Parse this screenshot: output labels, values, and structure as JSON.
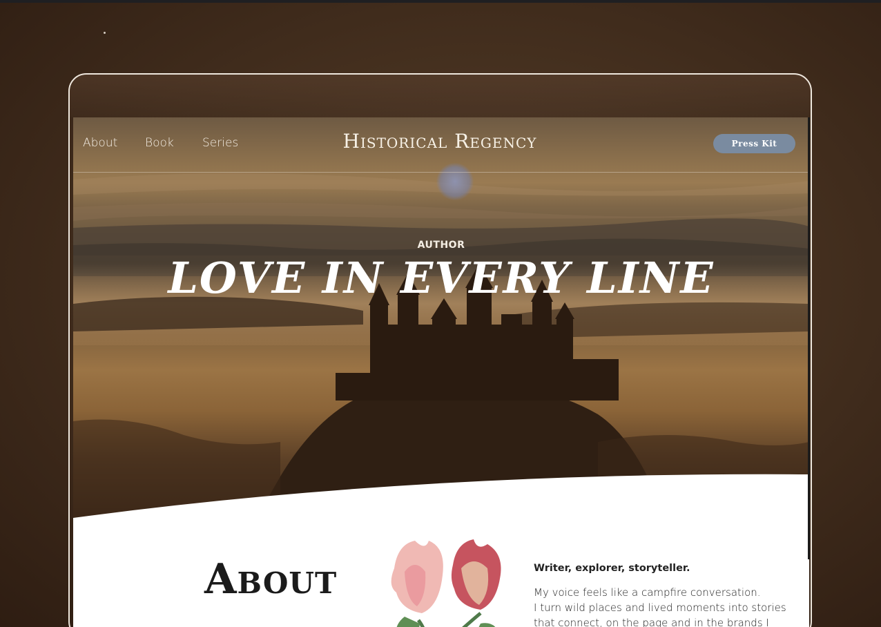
{
  "nav": {
    "links": [
      {
        "label": "About"
      },
      {
        "label": "Book"
      },
      {
        "label": "Series"
      }
    ],
    "brand": "Historical Regency",
    "cta": "Press Kit"
  },
  "hero": {
    "eyebrow": "AUTHOR",
    "headline": "Love in every line"
  },
  "about": {
    "title": "About",
    "tagline": "Writer, explorer, storyteller.",
    "line1": "My voice feels like a campfire conversation.",
    "line2": "I turn wild places and lived moments into stories that connect, on the page and in the brands I partner with."
  },
  "colors": {
    "accent_button": "#7a8ba0",
    "background": "#45301f"
  }
}
